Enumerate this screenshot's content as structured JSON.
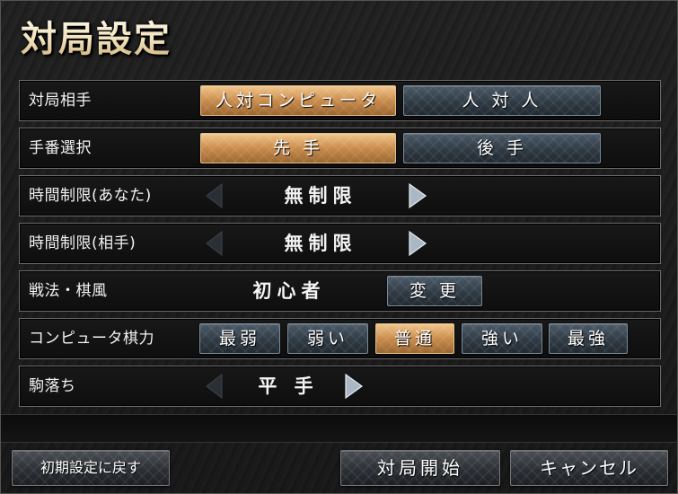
{
  "title": "対局設定",
  "rows": {
    "opponent": {
      "label": "対局相手",
      "options": [
        "人対コンピュータ",
        "人 対 人"
      ],
      "selected": "人対コンピュータ"
    },
    "turn": {
      "label": "手番選択",
      "options": [
        "先 手",
        "後 手"
      ],
      "selected": "先 手"
    },
    "time_you": {
      "label": "時間制限(あなた)",
      "value": "無制限"
    },
    "time_opponent": {
      "label": "時間制限(相手)",
      "value": "無制限"
    },
    "style": {
      "label": "戦法・棋風",
      "value": "初心者",
      "change_label": "変 更"
    },
    "strength": {
      "label": "コンピュータ棋力",
      "options": [
        "最弱",
        "弱い",
        "普通",
        "強い",
        "最強"
      ],
      "selected": "普通"
    },
    "handicap": {
      "label": "駒落ち",
      "value": "平 手"
    }
  },
  "footer": {
    "reset_label": "初期設定に戻す",
    "start_label": "対局開始",
    "cancel_label": "キャンセル"
  },
  "icons": {
    "left": "chevron-left-icon",
    "right": "chevron-right-icon"
  },
  "colors": {
    "active_button": "#c98c4c",
    "inactive_button": "#34414c"
  }
}
